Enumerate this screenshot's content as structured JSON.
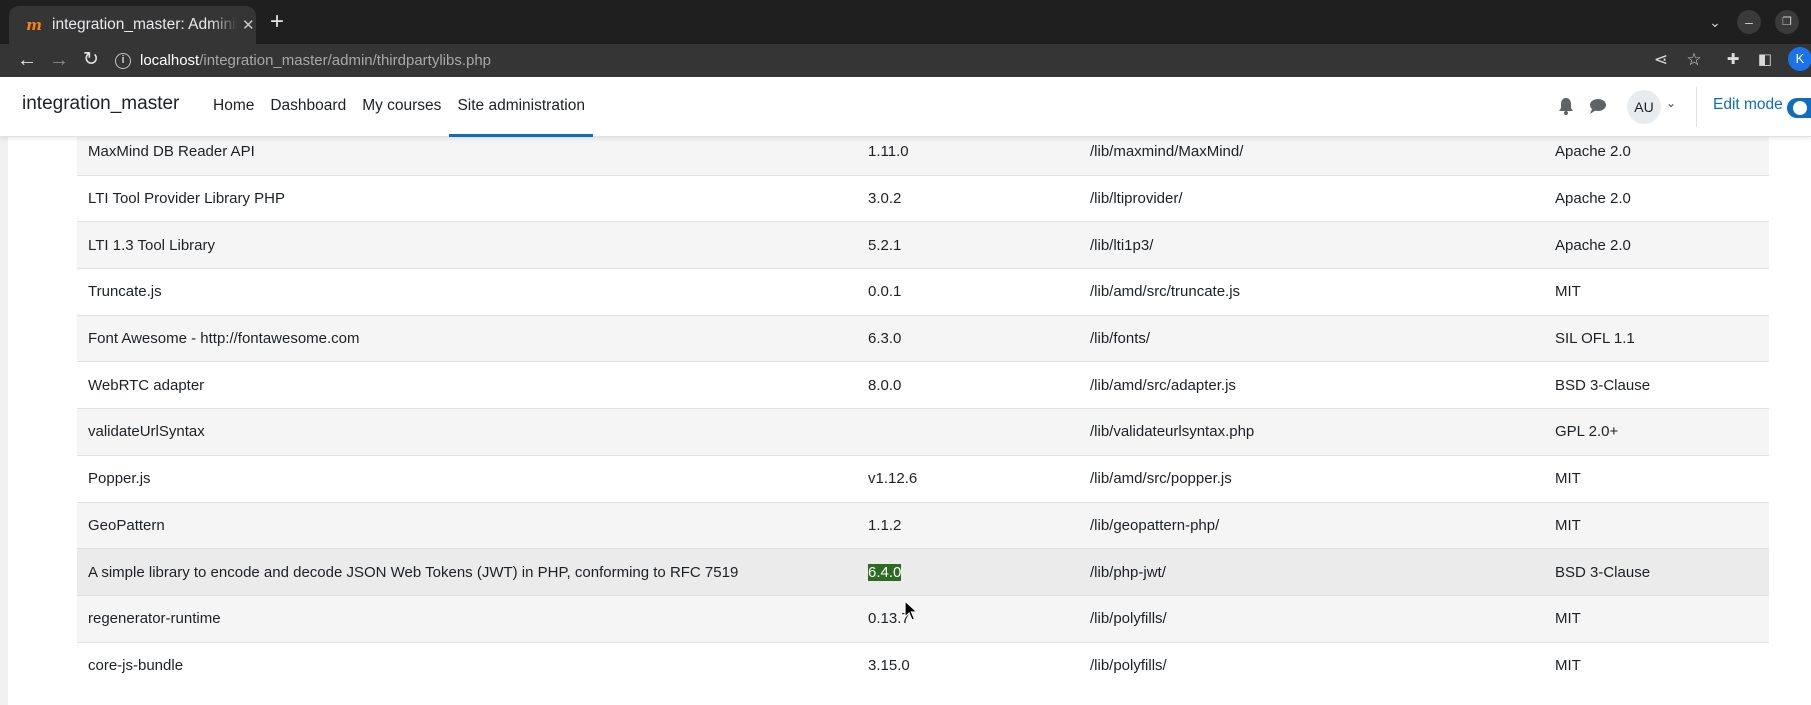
{
  "browser": {
    "tab_title": "integration_master: Administration",
    "tab_close": "✕",
    "new_tab": "+",
    "url_host": "localhost",
    "url_path": "/integration_master/admin/thirdpartylibs.php",
    "profile_initial": "K"
  },
  "site": {
    "brand": "integration_master",
    "nav": [
      {
        "label": "Home"
      },
      {
        "label": "Dashboard"
      },
      {
        "label": "My courses"
      },
      {
        "label": "Site administration"
      }
    ],
    "user_initials": "AU",
    "edit_mode_label": "Edit mode",
    "accent_color": "#0f6cbf"
  },
  "libraries": [
    {
      "name": "MaxMind DB Reader API",
      "version": "1.11.0",
      "location": "/lib/maxmind/MaxMind/",
      "license": "Apache 2.0"
    },
    {
      "name": "LTI Tool Provider Library PHP",
      "version": "3.0.2",
      "location": "/lib/ltiprovider/",
      "license": "Apache 2.0"
    },
    {
      "name": "LTI 1.3 Tool Library",
      "version": "5.2.1",
      "location": "/lib/lti1p3/",
      "license": "Apache 2.0"
    },
    {
      "name": "Truncate.js",
      "version": "0.0.1",
      "location": "/lib/amd/src/truncate.js",
      "license": "MIT"
    },
    {
      "name": "Font Awesome - http://fontawesome.com",
      "version": "6.3.0",
      "location": "/lib/fonts/",
      "license": "SIL OFL 1.1"
    },
    {
      "name": "WebRTC adapter",
      "version": "8.0.0",
      "location": "/lib/amd/src/adapter.js",
      "license": "BSD 3-Clause"
    },
    {
      "name": "validateUrlSyntax",
      "version": "",
      "location": "/lib/validateurlsyntax.php",
      "license": "GPL 2.0+"
    },
    {
      "name": "Popper.js",
      "version": "v1.12.6",
      "location": "/lib/amd/src/popper.js",
      "license": "MIT"
    },
    {
      "name": "GeoPattern",
      "version": "1.1.2",
      "location": "/lib/geopattern-php/",
      "license": "MIT"
    },
    {
      "name": "A simple library to encode and decode JSON Web Tokens (JWT) in PHP, conforming to RFC 7519",
      "version": "6.4.0",
      "location": "/lib/php-jwt/",
      "license": "BSD 3-Clause"
    },
    {
      "name": "regenerator-runtime",
      "version": "0.13.7",
      "location": "/lib/polyfills/",
      "license": "MIT"
    },
    {
      "name": "core-js-bundle",
      "version": "3.15.0",
      "location": "/lib/polyfills/",
      "license": "MIT"
    }
  ]
}
